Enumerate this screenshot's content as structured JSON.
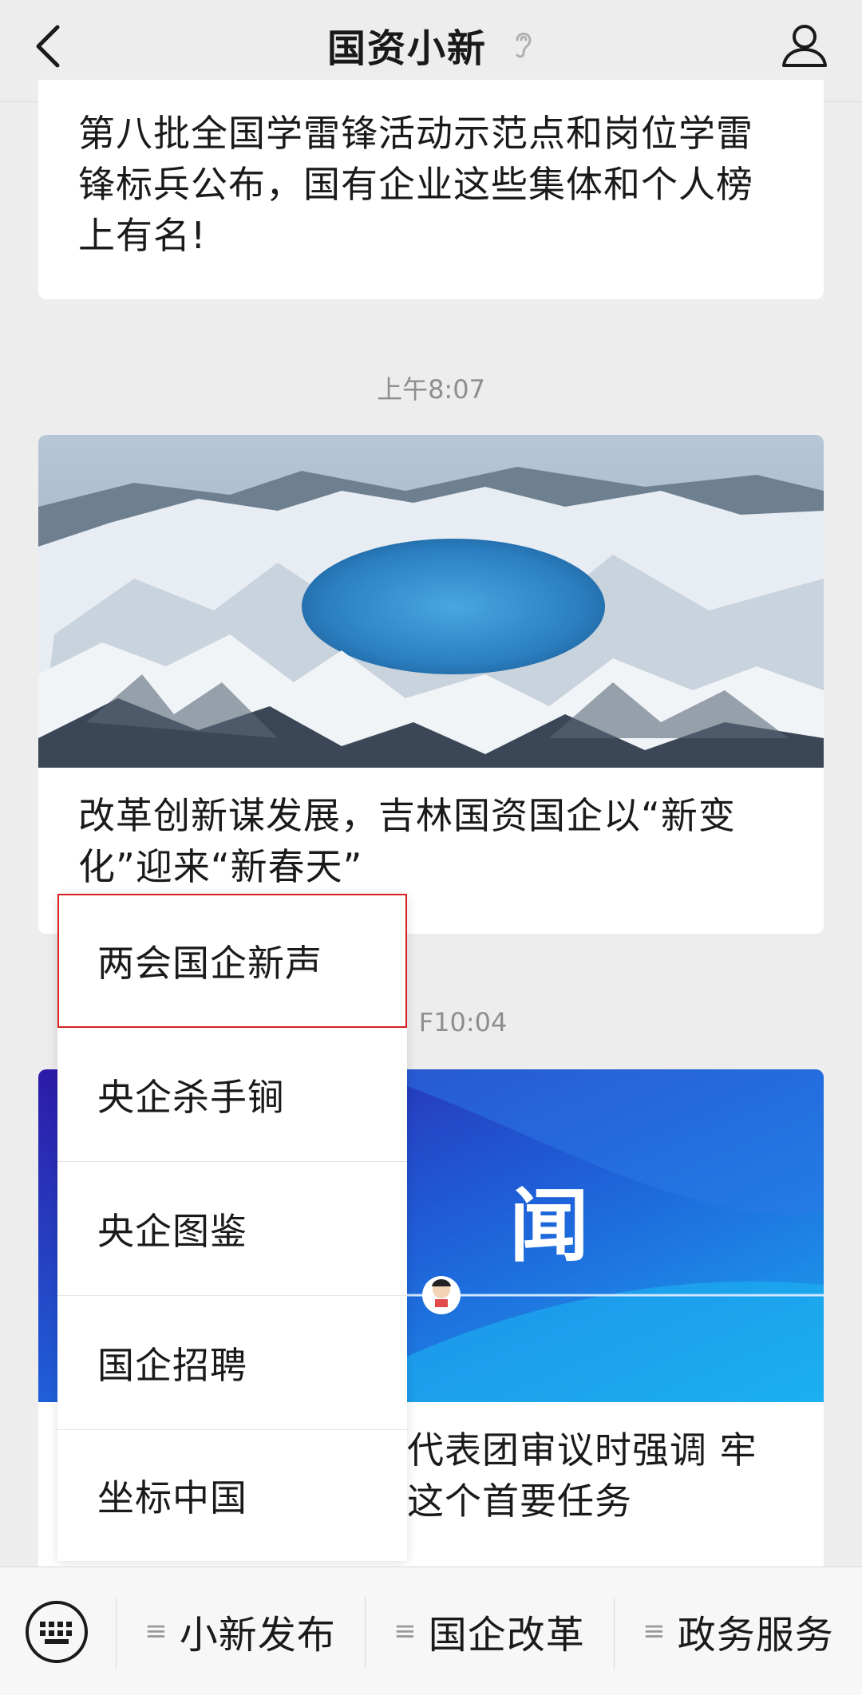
{
  "header": {
    "title": "国资小新"
  },
  "feed": {
    "card1": {
      "title": "第八批全国学雷锋活动示范点和岗位学雷锋标兵公布，国有企业这些集体和个人榜上有名!"
    },
    "timestamp1": "上午8:07",
    "card2": {
      "title": "改革创新谋发展，吉林国资国企以“新变化”迎来“新春天”"
    },
    "timestamp2": "F10:04",
    "card3": {
      "image_text": "闻",
      "title": "代表团审议时强调 牢这个首要任务"
    }
  },
  "popup_menu": {
    "items": [
      {
        "label": "两会国企新声",
        "selected": true
      },
      {
        "label": "央企杀手锏"
      },
      {
        "label": "央企图鉴"
      },
      {
        "label": "国企招聘"
      },
      {
        "label": "坐标中国"
      }
    ]
  },
  "bottom_bar": {
    "tabs": [
      {
        "label": "小新发布"
      },
      {
        "label": "国企改革"
      },
      {
        "label": "政务服务"
      }
    ]
  }
}
